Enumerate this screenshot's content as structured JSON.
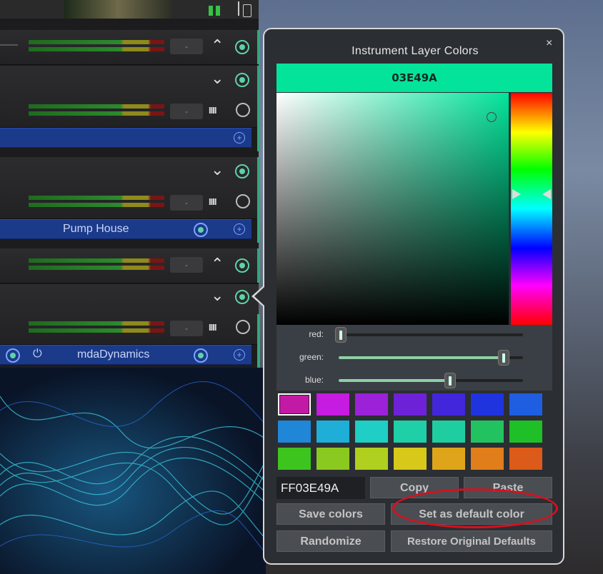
{
  "tracks": {
    "plugin_names": [
      "Pump House",
      "mdaDynamics"
    ],
    "meter_button_label": "-"
  },
  "popup": {
    "title": "Instrument Layer Colors",
    "close_label": "×",
    "hex_banner": "03E49A",
    "sliders": [
      {
        "label": "red:",
        "value": 3
      },
      {
        "label": "green:",
        "value": 228
      },
      {
        "label": "blue:",
        "value": 154
      }
    ],
    "swatches": [
      "#c31aa6",
      "#c61be0",
      "#9b22d8",
      "#6e22d8",
      "#4226dc",
      "#1f34de",
      "#1f5ee0",
      "#1f86d8",
      "#1faed8",
      "#1fcec4",
      "#1fcfa8",
      "#1fcea0",
      "#23c260",
      "#1fbf28",
      "#3ec41f",
      "#8ac91f",
      "#b0d01f",
      "#d7c81a",
      "#dfa51a",
      "#df7e1a",
      "#dc5a1a"
    ],
    "hex_input_value": "FF03E49A",
    "buttons": {
      "copy": "Copy",
      "paste": "Paste",
      "save_colors": "Save colors",
      "set_default": "Set as default color",
      "randomize": "Randomize",
      "restore_defaults": "Restore Original Defaults"
    },
    "selected_color": "#03E49A"
  },
  "colors": {
    "accent": "#2fa97a",
    "highlight_annotation": "#d8101e"
  }
}
